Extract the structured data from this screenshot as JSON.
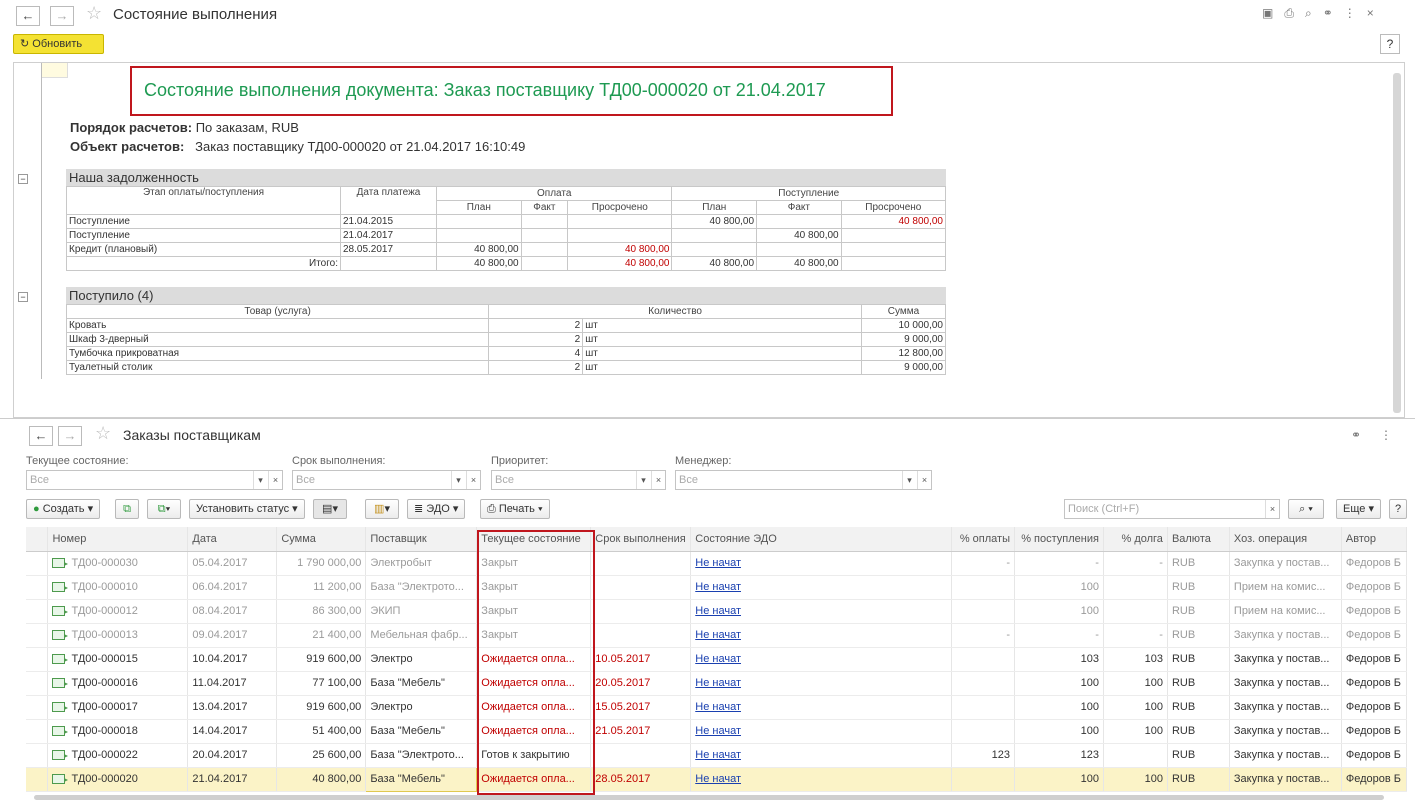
{
  "top_window": {
    "title": "Состояние выполнения",
    "refresh_label": "Обновить",
    "help_label": "?",
    "tool_icons": [
      "save-icon",
      "print-icon",
      "preview-icon",
      "link-icon",
      "more-icon",
      "close-icon"
    ]
  },
  "report": {
    "heading": "Состояние выполнения документа: Заказ поставщику ТД00-000020 от 21.04.2017",
    "line1_label": "Порядок расчетов:",
    "line1_value": "По заказам, RUB",
    "line2_label": "Объект расчетов:",
    "line2_value": "Заказ поставщику ТД00-000020 от 21.04.2017 16:10:49",
    "debt": {
      "title": "Наша задолженность",
      "col_stage": "Этап оплаты/поступления",
      "col_date": "Дата платежа",
      "grp_pay": "Оплата",
      "grp_recv": "Поступление",
      "sub": [
        "План",
        "Факт",
        "Просрочено",
        "План",
        "Факт",
        "Просрочено"
      ],
      "rows": [
        [
          "Поступление",
          "21.04.2015",
          "",
          "",
          "",
          "40 800,00",
          "",
          "40 800,00"
        ],
        [
          "Поступление",
          "21.04.2017",
          "",
          "",
          "",
          "",
          "40 800,00",
          ""
        ],
        [
          "Кредит (плановый)",
          "28.05.2017",
          "40 800,00",
          "",
          "40 800,00",
          "",
          "",
          ""
        ]
      ],
      "total": [
        "Итого:",
        "",
        "40 800,00",
        "",
        "40 800,00",
        "40 800,00",
        "40 800,00",
        ""
      ]
    },
    "received": {
      "title": "Поступило (4)",
      "col_item": "Товар (услуга)",
      "col_qty": "Количество",
      "col_sum": "Сумма",
      "rows": [
        [
          "Кровать",
          "2",
          "шт",
          "10 000,00"
        ],
        [
          "Шкаф 3-дверный",
          "2",
          "шт",
          "9 000,00"
        ],
        [
          "Тумбочка прикроватная",
          "4",
          "шт",
          "12 800,00"
        ],
        [
          "Туалетный столик",
          "2",
          "шт",
          "9 000,00"
        ]
      ]
    }
  },
  "orders": {
    "title": "Заказы поставщикам",
    "filters": [
      {
        "label": "Текущее состояние:",
        "value": "Все"
      },
      {
        "label": "Срок выполнения:",
        "value": "Все"
      },
      {
        "label": "Приоритет:",
        "value": "Все"
      },
      {
        "label": "Менеджер:",
        "value": "Все"
      }
    ],
    "toolbar": {
      "create": "Создать",
      "set_status": "Установить статус",
      "edo": "ЭДО",
      "print": "Печать",
      "search_placeholder": "Поиск (Ctrl+F)",
      "more": "Еще",
      "help": "?"
    },
    "columns": [
      "Номер",
      "Дата",
      "Сумма",
      "Поставщик",
      "Текущее состояние",
      "Срок выполнения",
      "Состояние ЭДО",
      "% оплаты",
      "% поступления",
      "% долга",
      "Валюта",
      "Хоз. операция",
      "Автор"
    ],
    "rows": [
      [
        "ТД00-000030",
        "05.04.2017",
        "1 790 000,00",
        "Электробыт",
        "Закрыт",
        "",
        "Не начат",
        "-",
        "-",
        "-",
        "RUB",
        "Закупка у постав...",
        "Федоров Б"
      ],
      [
        "ТД00-000010",
        "06.04.2017",
        "11 200,00",
        "База \"Электрото...",
        "Закрыт",
        "",
        "Не начат",
        "",
        "100",
        "",
        "RUB",
        "Прием на комис...",
        "Федоров Б"
      ],
      [
        "ТД00-000012",
        "08.04.2017",
        "86 300,00",
        "ЭКИП",
        "Закрыт",
        "",
        "Не начат",
        "",
        "100",
        "",
        "RUB",
        "Прием на комис...",
        "Федоров Б"
      ],
      [
        "ТД00-000013",
        "09.04.2017",
        "21 400,00",
        "Мебельная фабр...",
        "Закрыт",
        "",
        "Не начат",
        "-",
        "-",
        "-",
        "RUB",
        "Закупка у постав...",
        "Федоров Б"
      ],
      [
        "ТД00-000015",
        "10.04.2017",
        "919 600,00",
        "Электро",
        "Ожидается опла...",
        "10.05.2017",
        "Не начат",
        "",
        "103",
        "103",
        "RUB",
        "Закупка у постав...",
        "Федоров Б"
      ],
      [
        "ТД00-000016",
        "11.04.2017",
        "77 100,00",
        "База \"Мебель\"",
        "Ожидается опла...",
        "20.05.2017",
        "Не начат",
        "",
        "100",
        "100",
        "RUB",
        "Закупка у постав...",
        "Федоров Б"
      ],
      [
        "ТД00-000017",
        "13.04.2017",
        "919 600,00",
        "Электро",
        "Ожидается опла...",
        "15.05.2017",
        "Не начат",
        "",
        "100",
        "100",
        "RUB",
        "Закупка у постав...",
        "Федоров Б"
      ],
      [
        "ТД00-000018",
        "14.04.2017",
        "51 400,00",
        "База \"Мебель\"",
        "Ожидается опла...",
        "21.05.2017",
        "Не начат",
        "",
        "100",
        "100",
        "RUB",
        "Закупка у постав...",
        "Федоров Б"
      ],
      [
        "ТД00-000022",
        "20.04.2017",
        "25 600,00",
        "База \"Электрото...",
        "Готов к закрытию",
        "",
        "Не начат",
        "123",
        "123",
        "",
        "RUB",
        "Закупка у постав...",
        "Федоров Б"
      ],
      [
        "ТД00-000020",
        "21.04.2017",
        "40 800,00",
        "База \"Мебель\"",
        "Ожидается опла...",
        "28.05.2017",
        "Не начат",
        "",
        "100",
        "100",
        "RUB",
        "Закупка у постав...",
        "Федоров Б"
      ]
    ],
    "row_styles": [
      "gray",
      "gray",
      "gray",
      "gray",
      "",
      "",
      "",
      "",
      "",
      "sel"
    ]
  },
  "colors": {
    "heading": "#1e9a52",
    "overdue": "#c00000",
    "highlight_box": "#c0161d",
    "refresh_btn": "#f4e233",
    "link": "#1a40b0"
  }
}
